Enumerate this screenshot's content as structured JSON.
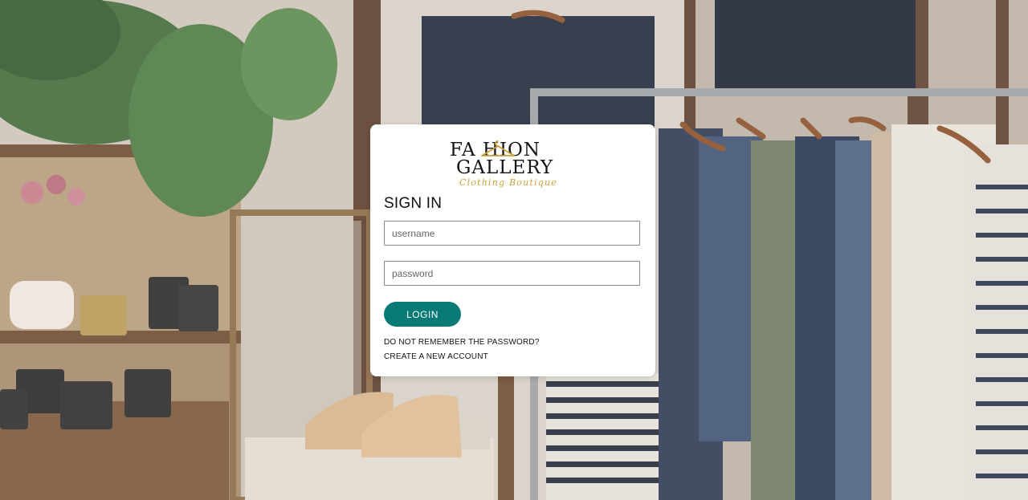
{
  "brand": {
    "line1": "FA  HION",
    "line2": "GALLERY",
    "tagline": "Clothing Boutique",
    "accent_color": "#c9a23a",
    "icon": "hanger-icon"
  },
  "form": {
    "heading": "SIGN IN",
    "username_placeholder": "username",
    "password_placeholder": "password",
    "login_label": "LOGIN",
    "forgot_link": "DO NOT REMEMBER THE PASSWORD?",
    "create_link": "CREATE A NEW ACCOUNT",
    "button_color": "#0a7a76"
  }
}
